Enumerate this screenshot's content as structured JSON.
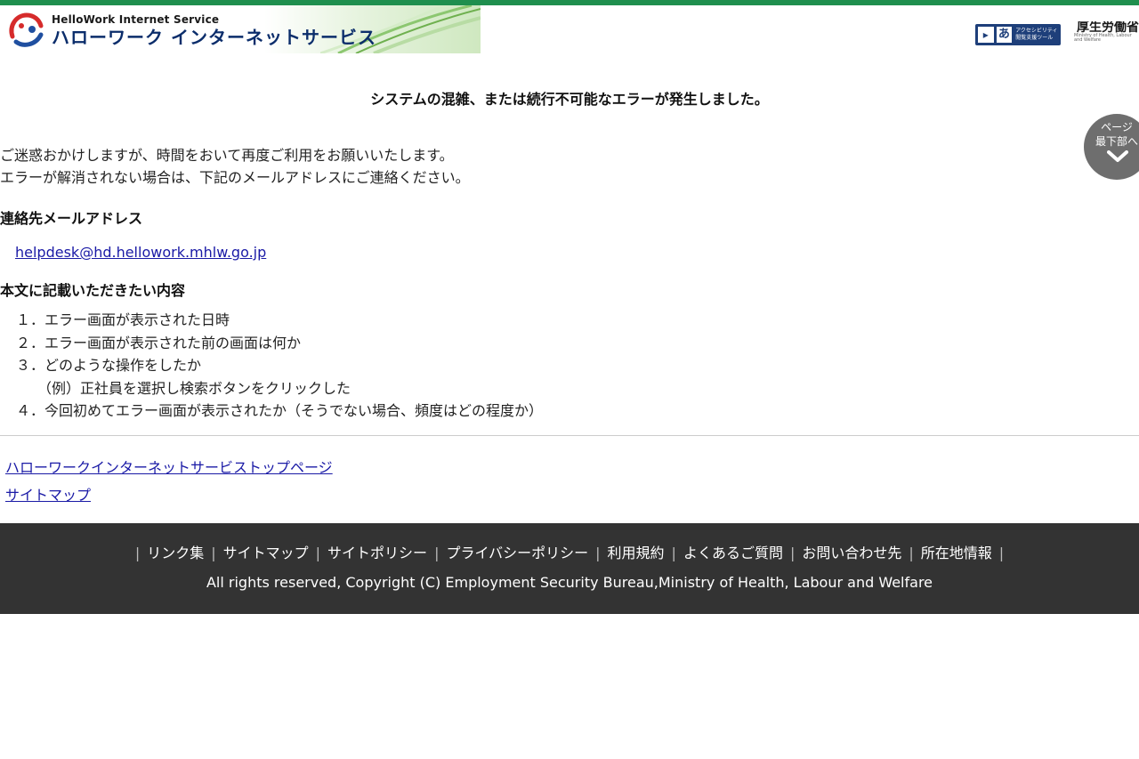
{
  "header": {
    "logo_en": "HelloWork Internet Service",
    "logo_jp": "ハローワーク インターネットサービス",
    "accessibility_label": "アクセシビリティ 閲覧支援ツール",
    "accessibility_a": "あ",
    "ministry_name": "厚生労働省",
    "ministry_sub": "Ministry of Health, Labour and Welfare"
  },
  "main": {
    "error_title": "システムの混雑、または続行不可能なエラーが発生しました。",
    "message_line1": "ご迷惑おかけしますが、時間をおいて再度ご利用をお願いいたします。",
    "message_line2": "エラーが解消されない場合は、下記のメールアドレスにご連絡ください。",
    "contact_heading": "連絡先メールアドレス",
    "contact_email": "helpdesk@hd.hellowork.mhlw.go.jp",
    "content_heading": "本文に記載いただきたい内容",
    "items": [
      "１．エラー画面が表示された日時",
      "２．エラー画面が表示された前の画面は何か",
      "３．どのような操作をしたか",
      "（例）正社員を選択し検索ボタンをクリックした",
      "４．今回初めてエラー画面が表示されたか（そうでない場合、頻度はどの程度か）"
    ]
  },
  "links": {
    "top_page": "ハローワークインターネットサービストップページ",
    "sitemap": "サイトマップ"
  },
  "page_bottom_button": {
    "line1": "ページ",
    "line2": "最下部へ"
  },
  "footer": {
    "separator": "|",
    "nav": [
      "リンク集",
      "サイトマップ",
      "サイトポリシー",
      "プライバシーポリシー",
      "利用規約",
      "よくあるご質問",
      "お問い合わせ先",
      "所在地情報"
    ],
    "copyright": "All rights reserved, Copyright (C) Employment Security Bureau,Ministry of Health, Labour and Welfare"
  },
  "colors": {
    "top_bar": "#1f8f4e",
    "footer_bg": "#333333",
    "link": "#1a1aa6",
    "logo_blue": "#0b2d6b"
  }
}
